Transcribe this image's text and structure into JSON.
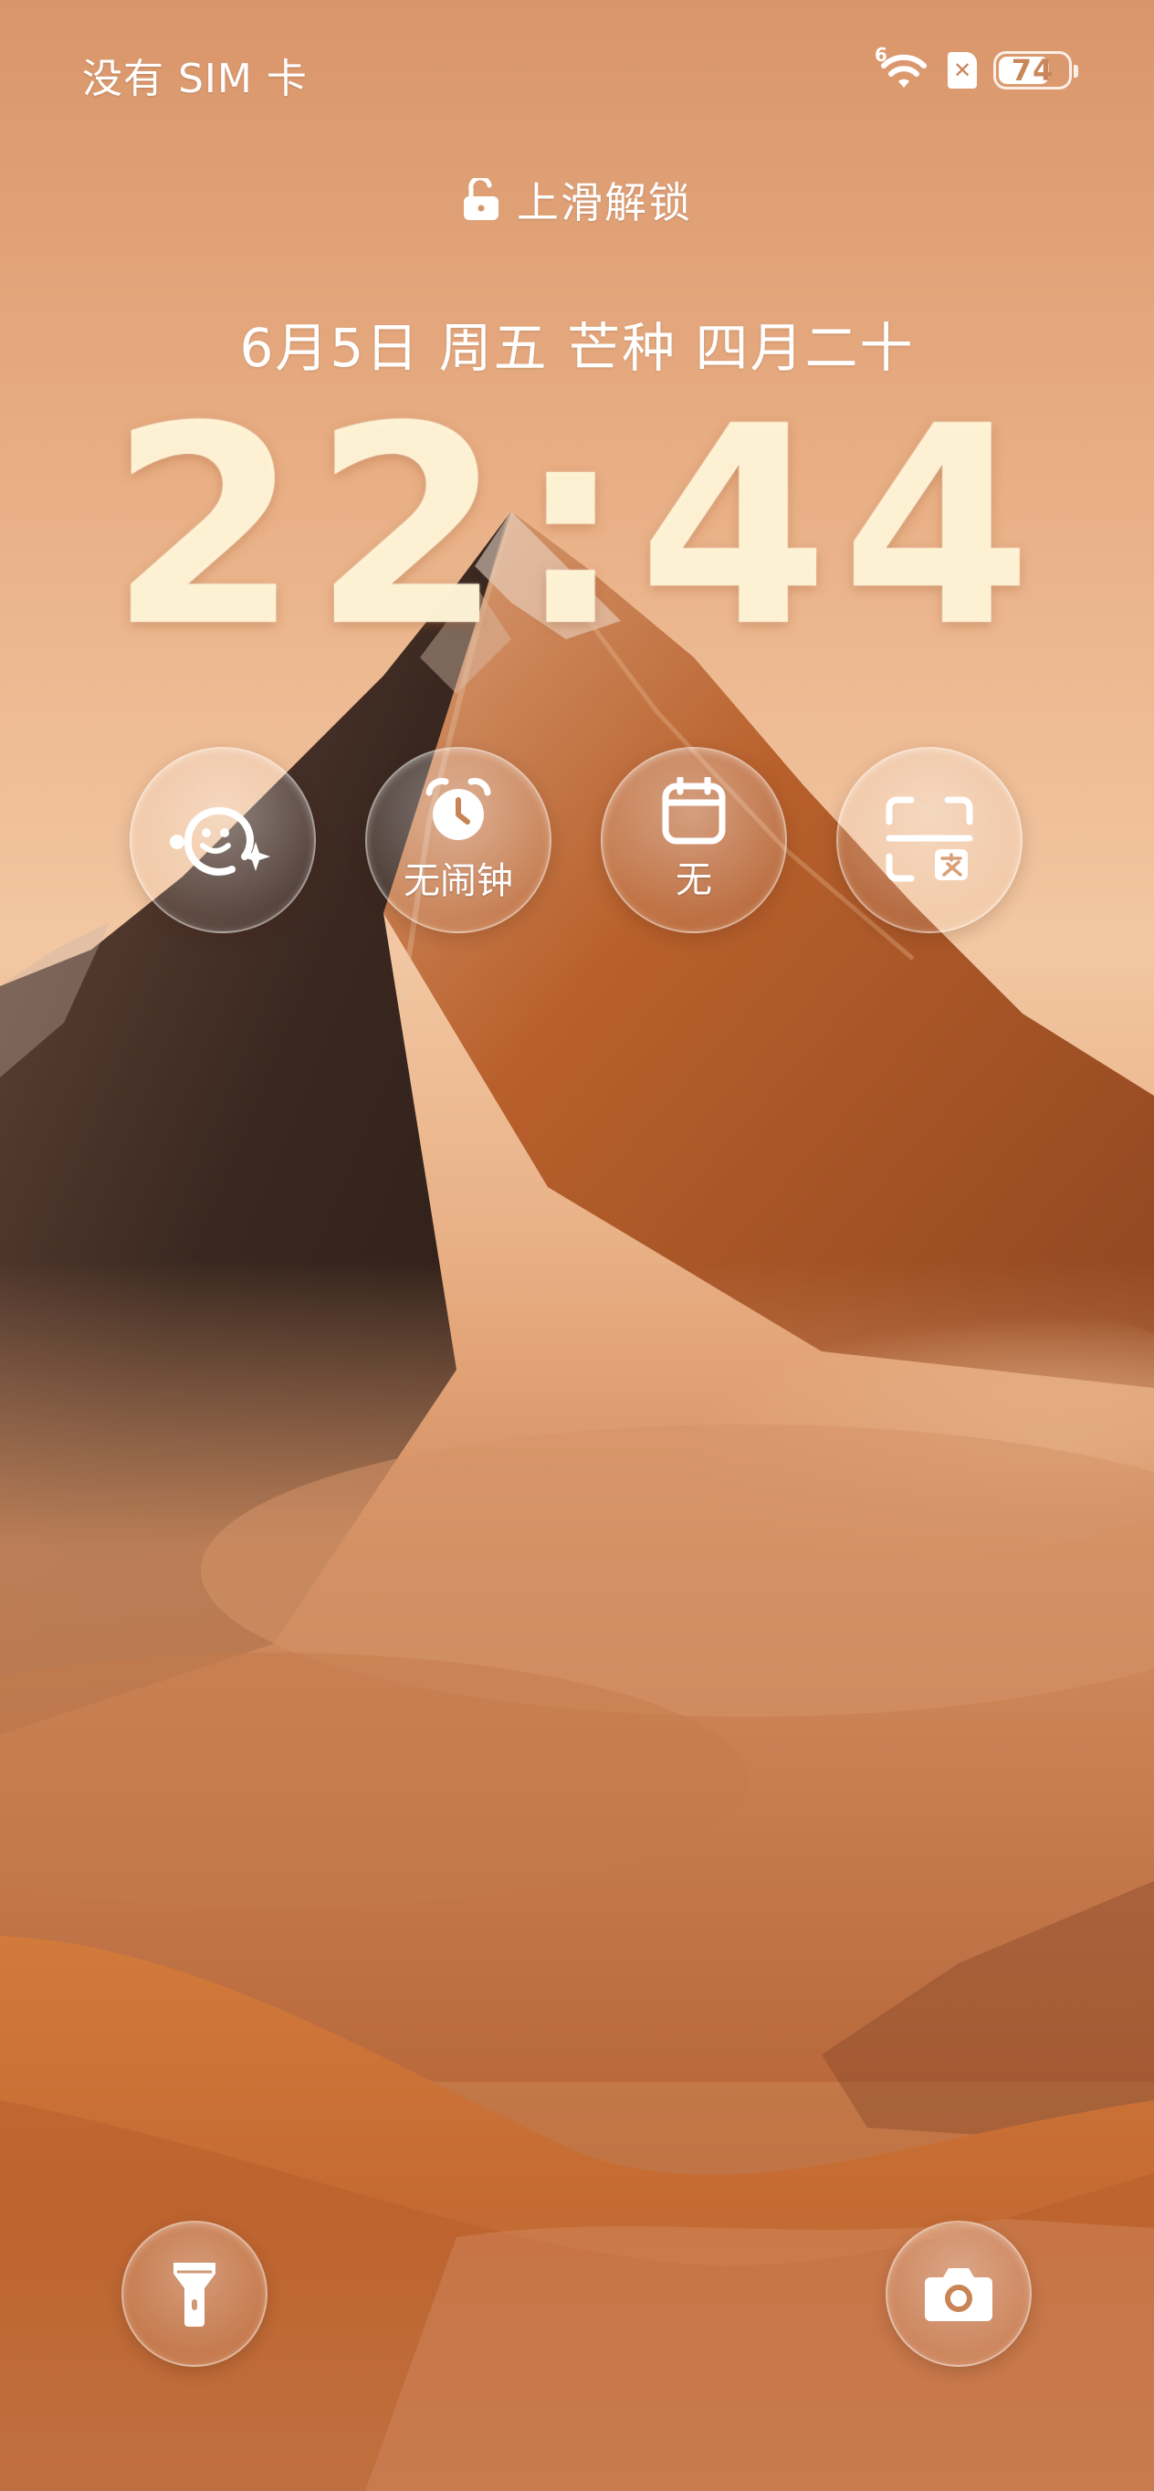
{
  "status_bar": {
    "carrier": "没有 SIM 卡",
    "wifi_generation": "6",
    "battery_level": "74",
    "battery_fraction": 0.74
  },
  "lock": {
    "hint": "上滑解锁"
  },
  "datetime": {
    "date": "6月5日 周五 芒种 四月二十",
    "time": "22:44"
  },
  "widgets": {
    "assistant": {
      "icon": "ai-assistant-icon"
    },
    "alarm": {
      "icon": "alarm-clock-icon",
      "label": "无闹钟"
    },
    "calendar": {
      "icon": "calendar-icon",
      "label": "无"
    },
    "scan": {
      "icon": "scan-translate-icon"
    }
  },
  "shortcuts": {
    "left": {
      "icon": "flashlight-icon"
    },
    "right": {
      "icon": "camera-icon"
    }
  },
  "colors": {
    "sky_top": "#d9956a",
    "sky_mid": "#f0c29a",
    "mountain_dark": "#3d2a22",
    "mountain_orange": "#b8602c",
    "mist": "#c98456",
    "grass": "#c46a32",
    "clock_fill": "#fff4d6"
  }
}
